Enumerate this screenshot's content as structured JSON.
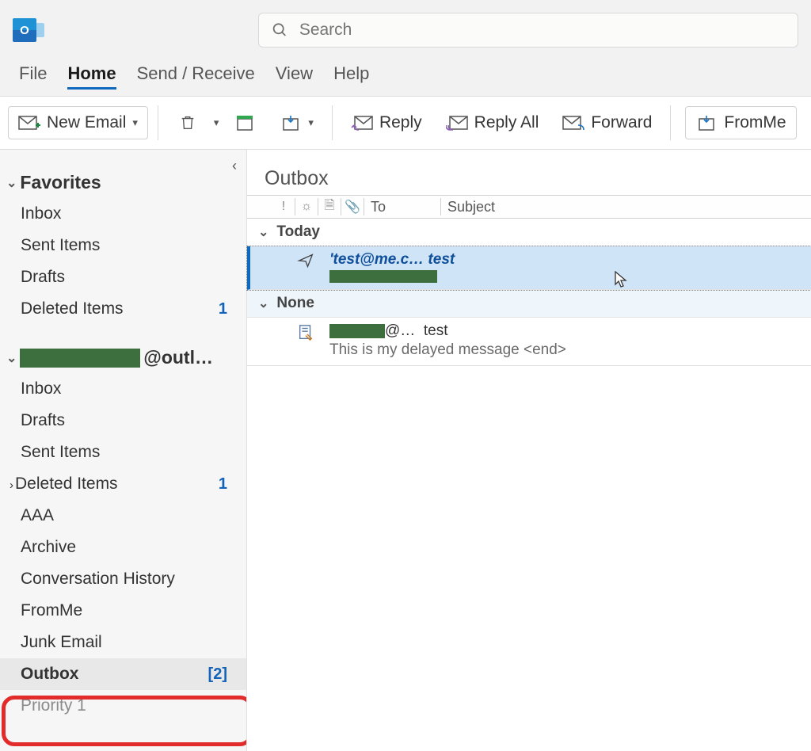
{
  "search": {
    "placeholder": "Search"
  },
  "menu": {
    "file": "File",
    "home": "Home",
    "sendrecv": "Send / Receive",
    "view": "View",
    "help": "Help"
  },
  "ribbon": {
    "new_email": "New Email",
    "reply": "Reply",
    "reply_all": "Reply All",
    "forward": "Forward",
    "fromme": "FromMe"
  },
  "sidebar": {
    "favorites_label": "Favorites",
    "favorites": [
      {
        "label": "Inbox",
        "badge": ""
      },
      {
        "label": "Sent Items",
        "badge": ""
      },
      {
        "label": "Drafts",
        "badge": ""
      },
      {
        "label": "Deleted Items",
        "badge": "1"
      }
    ],
    "account_suffix": "@outl…",
    "folders": [
      {
        "label": "Inbox",
        "badge": ""
      },
      {
        "label": "Drafts",
        "badge": ""
      },
      {
        "label": "Sent Items",
        "badge": ""
      },
      {
        "label": "Deleted Items",
        "badge": "1",
        "expandable": true
      },
      {
        "label": "AAA",
        "badge": ""
      },
      {
        "label": "Archive",
        "badge": ""
      },
      {
        "label": "Conversation History",
        "badge": ""
      },
      {
        "label": "FromMe",
        "badge": ""
      },
      {
        "label": "Junk Email",
        "badge": ""
      },
      {
        "label": "Outbox",
        "badge": "[2]",
        "selected": true
      },
      {
        "label": "Priority 1",
        "badge": ""
      }
    ]
  },
  "main": {
    "title": "Outbox",
    "columns": {
      "to": "To",
      "subject": "Subject"
    },
    "groups": {
      "today": "Today",
      "none": "None"
    },
    "rows": [
      {
        "to": "'test@me.c…",
        "subject": "test"
      },
      {
        "to_suffix": "@…",
        "subject": "test",
        "preview": "This is my delayed message <end>"
      }
    ]
  }
}
